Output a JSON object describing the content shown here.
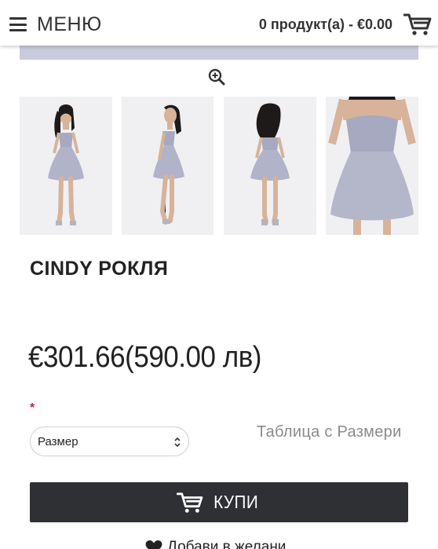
{
  "header": {
    "menu_label": "МЕНЮ",
    "cart_summary": "0 продукт(а) - €0.00",
    "icons": {
      "menu": "hamburger-icon",
      "cart": "shopping-cart-icon"
    }
  },
  "gallery": {
    "zoom_icon": "zoom-in-icon",
    "thumbnails": [
      {
        "name": "dress-front-view"
      },
      {
        "name": "dress-side-view"
      },
      {
        "name": "dress-back-view"
      },
      {
        "name": "dress-closeup-view"
      }
    ]
  },
  "product": {
    "title": "CINDY РОКЛЯ",
    "price": "€301.66(590.00 лв)",
    "required_mark": "*",
    "size_select": {
      "selected": "Размер"
    },
    "size_table_link": "Таблица с Размери",
    "buy_label": "КУПИ",
    "wishlist_label": "Добави в желани"
  },
  "colors": {
    "button_bg": "#2f3033",
    "required": "#c0243a",
    "banner": "#c9cbdc",
    "dress": "#a7a9c0"
  }
}
